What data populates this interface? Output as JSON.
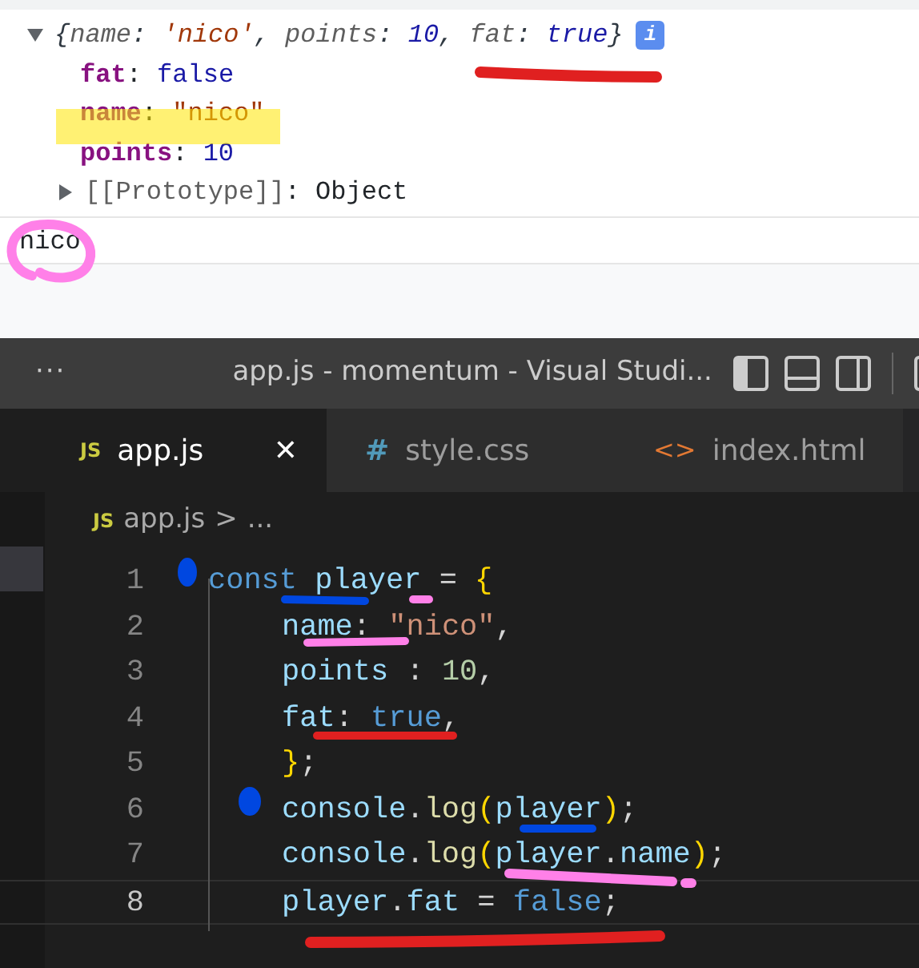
{
  "console": {
    "summary": [
      {
        "text": "{",
        "kind": "punct"
      },
      {
        "text": "name",
        "kind": "key"
      },
      {
        "text": ": ",
        "kind": "punct"
      },
      {
        "text": "'nico'",
        "kind": "string"
      },
      {
        "text": ", ",
        "kind": "punct"
      },
      {
        "text": "points",
        "kind": "key"
      },
      {
        "text": ": ",
        "kind": "punct"
      },
      {
        "text": "10",
        "kind": "number"
      },
      {
        "text": ", ",
        "kind": "punct"
      },
      {
        "text": "fat",
        "kind": "key"
      },
      {
        "text": ": ",
        "kind": "punct"
      },
      {
        "text": "true",
        "kind": "bool"
      },
      {
        "text": "}",
        "kind": "punct"
      }
    ],
    "expanded": true,
    "info_badge": "i",
    "properties": [
      {
        "key": "fat",
        "separator": ":",
        "value": "false",
        "kind": "bool"
      },
      {
        "key": "name",
        "separator": ":",
        "value": "\"nico\"",
        "kind": "string"
      },
      {
        "key": "points",
        "separator": ":",
        "value": "10",
        "kind": "number"
      }
    ],
    "prototype": {
      "key": "[[Prototype]]",
      "separator": ":",
      "value": "Object",
      "expanded": false
    },
    "output": "nico"
  },
  "editor": {
    "menu": "···",
    "title": "app.js - momentum - Visual Studi...",
    "tabs": [
      {
        "icon": "JS",
        "color": "#cbcb41",
        "label": "app.js",
        "selected": true,
        "close": "✕"
      },
      {
        "icon": "#",
        "color": "#519aba",
        "label": "style.css",
        "selected": false
      },
      {
        "icon": "<>",
        "color": "#e37933",
        "label": "index.html",
        "selected": false
      }
    ],
    "breadcrumb": {
      "icon": "JS",
      "file": "app.js",
      "separator": ">",
      "more": "..."
    },
    "lines": [
      {
        "number": "1",
        "selected": false,
        "indented": false,
        "tokens": [
          {
            "text": "const",
            "kind": "keyword"
          },
          {
            "text": " player",
            "kind": "variable"
          },
          {
            "text": " = ",
            "kind": "plain"
          },
          {
            "text": "{",
            "kind": "brace"
          }
        ]
      },
      {
        "number": "2",
        "selected": false,
        "indented": true,
        "tokens": [
          {
            "text": "name",
            "kind": "variable"
          },
          {
            "text": ": ",
            "kind": "plain"
          },
          {
            "text": "\"nico\"",
            "kind": "string"
          },
          {
            "text": ",",
            "kind": "plain"
          }
        ]
      },
      {
        "number": "3",
        "selected": false,
        "indented": true,
        "tokens": [
          {
            "text": "points",
            "kind": "variable"
          },
          {
            "text": " : ",
            "kind": "plain"
          },
          {
            "text": "10",
            "kind": "number"
          },
          {
            "text": ",",
            "kind": "plain"
          }
        ]
      },
      {
        "number": "4",
        "selected": false,
        "indented": true,
        "tokens": [
          {
            "text": "fat",
            "kind": "variable"
          },
          {
            "text": ": ",
            "kind": "plain"
          },
          {
            "text": "true",
            "kind": "keyword"
          },
          {
            "text": ",",
            "kind": "plain"
          }
        ]
      },
      {
        "number": "5",
        "selected": false,
        "indented": true,
        "tokens": [
          {
            "text": "}",
            "kind": "brace"
          },
          {
            "text": ";",
            "kind": "plain"
          }
        ]
      },
      {
        "number": "6",
        "selected": false,
        "indented": true,
        "tokens": [
          {
            "text": "console",
            "kind": "variable"
          },
          {
            "text": ".",
            "kind": "plain"
          },
          {
            "text": "log",
            "kind": "function"
          },
          {
            "text": "(",
            "kind": "brace"
          },
          {
            "text": "player",
            "kind": "variable"
          },
          {
            "text": ")",
            "kind": "brace"
          },
          {
            "text": ";",
            "kind": "plain"
          }
        ]
      },
      {
        "number": "7",
        "selected": false,
        "indented": true,
        "tokens": [
          {
            "text": "console",
            "kind": "variable"
          },
          {
            "text": ".",
            "kind": "plain"
          },
          {
            "text": "log",
            "kind": "function"
          },
          {
            "text": "(",
            "kind": "brace"
          },
          {
            "text": "player",
            "kind": "variable"
          },
          {
            "text": ".",
            "kind": "plain"
          },
          {
            "text": "name",
            "kind": "variable"
          },
          {
            "text": ")",
            "kind": "brace"
          },
          {
            "text": ";",
            "kind": "plain"
          }
        ]
      },
      {
        "number": "8",
        "selected": true,
        "indented": true,
        "tokens": [
          {
            "text": "player",
            "kind": "variable"
          },
          {
            "text": ".",
            "kind": "plain"
          },
          {
            "text": "fat",
            "kind": "variable"
          },
          {
            "text": " = ",
            "kind": "plain"
          },
          {
            "text": "false",
            "kind": "keyword"
          },
          {
            "text": ";",
            "kind": "plain"
          }
        ]
      }
    ]
  }
}
